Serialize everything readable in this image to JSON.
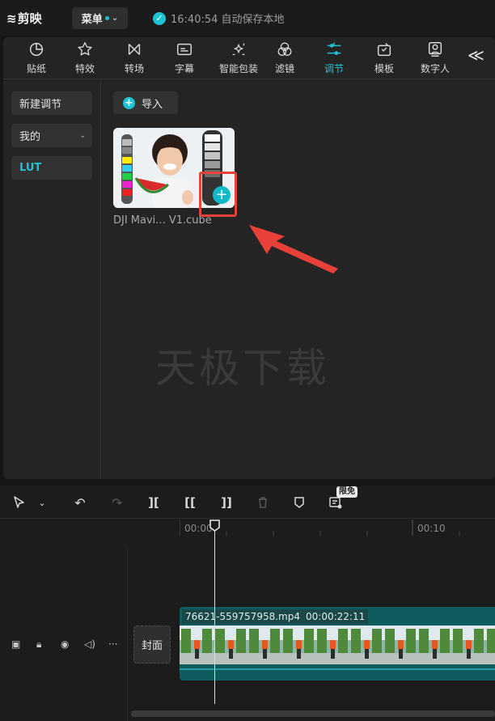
{
  "app": {
    "logo_text": "剪映",
    "menu_label": "菜单",
    "autosave_text": "16:40:54 自动保存本地"
  },
  "toolbar": {
    "items": [
      {
        "label": "贴纸",
        "icon": "sticker-icon"
      },
      {
        "label": "特效",
        "icon": "effects-star-icon"
      },
      {
        "label": "转场",
        "icon": "transition-icon"
      },
      {
        "label": "字幕",
        "icon": "subtitle-icon"
      },
      {
        "label": "智能包装",
        "icon": "smart-package-icon"
      },
      {
        "label": "滤镜",
        "icon": "filter-icon"
      },
      {
        "label": "调节",
        "icon": "adjust-sliders-icon",
        "active": true
      },
      {
        "label": "模板",
        "icon": "template-icon"
      },
      {
        "label": "数字人",
        "icon": "digital-human-icon"
      }
    ],
    "collapse_glyph": "≪"
  },
  "sidebar": {
    "items": [
      {
        "label": "新建调节"
      },
      {
        "label": "我的"
      },
      {
        "label": "LUT",
        "active": true
      }
    ]
  },
  "content": {
    "import_label": "导入",
    "lut_item_label": "DJI Mavi... V1.cube",
    "watermark": "天极下载"
  },
  "timeline": {
    "free_badge": "限免",
    "ruler_labels": [
      "00:00",
      "00:10"
    ],
    "cover_label": "封面",
    "clip_filename": "76621-559757958.mp4",
    "clip_duration": "00:00:22:11"
  },
  "colors": {
    "accent": "#1fc4d4",
    "highlight": "#e8413a",
    "clip": "#0f5c5e"
  }
}
